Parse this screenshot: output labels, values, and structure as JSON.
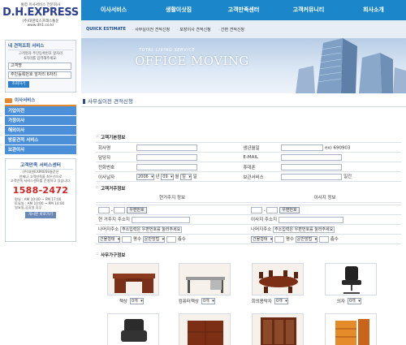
{
  "header": {
    "tagline": "통합 이사서비스 전문회사",
    "logo": "D.H.EXPRESS",
    "company": "(주)대한익스프레스통운",
    "url": "www.dh1.co.kr"
  },
  "top_nav": [
    "이사서비스",
    "생활이삿짐",
    "고객만족센터",
    "고객커뮤니티",
    "회사소개"
  ],
  "sub_nav": [
    "QUIICK ESTIMATE",
    "사무실이전 견적신청",
    "포장이사 견적신청",
    "간편 견적신청"
  ],
  "login": {
    "title": "내 견적조회 서비스",
    "desc1": "고객명과 주민등록번호 앞자리",
    "desc2": "6자리를 입력해주세요.",
    "name_value": "고객명",
    "id_value": "주민등록번호 앞자리 6자리",
    "button": "조회하기"
  },
  "moving_service": {
    "title": "이사서비스",
    "items": [
      "기업이전",
      "가정이사",
      "해외이사",
      "방문견적 서비스",
      "보관이사"
    ]
  },
  "cs": {
    "title": "고객만족 서비스센터",
    "desc1": "(주)대한EXPRESS통운은",
    "desc2": "언제나 고객만족을 최우선으로",
    "desc3": "고객만족 서비스센터를 운영하고 있습니다.",
    "phone": "1588-2472",
    "hours1": "평일 : AM 10:00 ~ PM 17:00",
    "hours2": "토요일 : AM 10:00 ~ PM 14:00",
    "hours3": "일요일,공휴일 휴무",
    "button": "게시판 바로가기"
  },
  "banner": {
    "subtitle": "TOTAL LIVING SERVICE",
    "title": "OFFICE MOVING"
  },
  "page_title": "사무실이전 견적신청",
  "customer_section": {
    "title": "고객기본정보",
    "company_label": "회사명",
    "birthday_label": "생년월일",
    "birthday_hint": "ex) 690903",
    "manager_label": "담당자",
    "email_label": "E-MAIL",
    "phone_label": "전화번호",
    "mobile_label": "휴대폰",
    "date_label": "이사날자",
    "year": "2006",
    "year_unit": "년",
    "month": "09",
    "month_unit": "월",
    "day": "일",
    "day_unit": "일",
    "storage_label": "보관서비스",
    "storage_unit": "일간"
  },
  "address_section": {
    "title": "고객거주정보",
    "current_head": "현거주지 정보",
    "move_head": "이사지 정보",
    "zip_button": "우편번호",
    "current_addr": "현 거주지 주소지",
    "move_addr": "이사지 주소지",
    "remaining_label": "나머지주소",
    "remaining_hint": "주소입력은 우편번호를 눌러주세요",
    "building_select": "건물형태",
    "pyeong": "평수",
    "elevator_select": "운반방법",
    "floor": "층수"
  },
  "goods_section": {
    "title": "사무가구정보",
    "items": [
      {
        "name": "책상",
        "qty": "0개"
      },
      {
        "name": "컴퓨터책상",
        "qty": "0개"
      },
      {
        "name": "회의용탁자",
        "qty": "0개"
      },
      {
        "name": "의자",
        "qty": "0개"
      }
    ]
  }
}
